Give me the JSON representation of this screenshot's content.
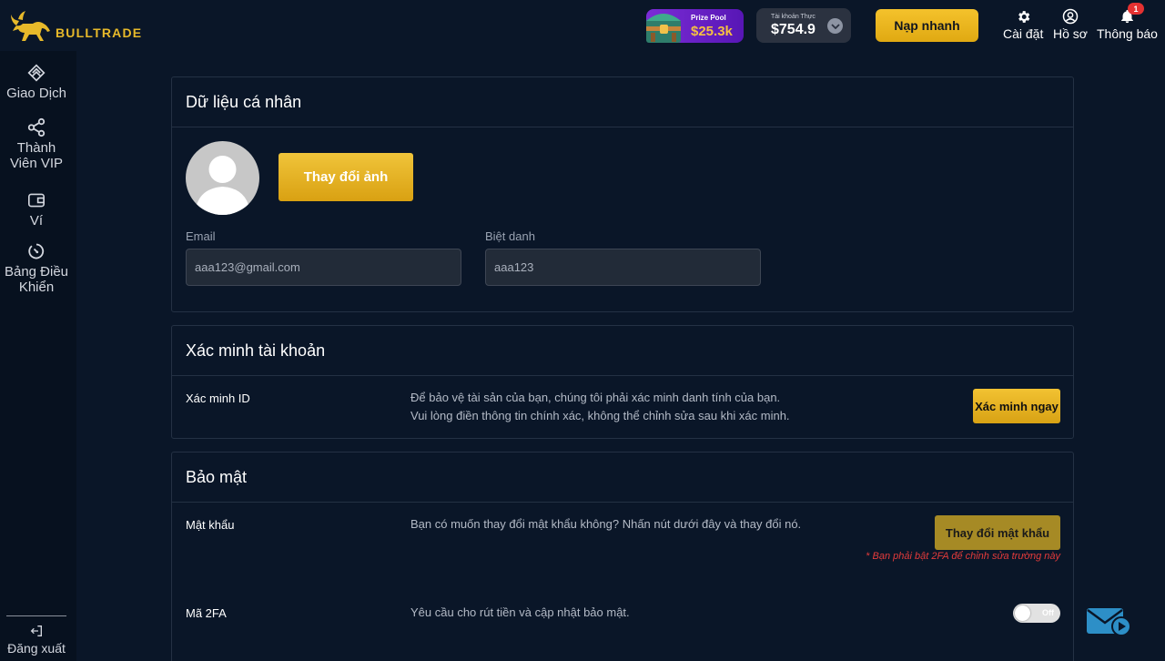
{
  "brand": {
    "name": "BULLTRADE",
    "accent": "#e7b92a"
  },
  "header": {
    "prize_pool": {
      "label": "Prize Pool",
      "value": "$25.3k"
    },
    "account": {
      "label": "Tài khoản Thực",
      "value": "$754.9"
    },
    "deposit_label": "Nạp nhanh",
    "settings_label": "Cài đặt",
    "profile_label": "Hồ sơ",
    "notifications_label": "Thông báo",
    "notifications_count": "1"
  },
  "sidebar": {
    "items": [
      {
        "label": "Giao Dịch",
        "icon": "trade-icon"
      },
      {
        "label": "Thành Viên VIP",
        "icon": "share-icon"
      },
      {
        "label": "Ví",
        "icon": "wallet-icon"
      },
      {
        "label": "Bảng Điều Khiển",
        "icon": "dashboard-icon"
      }
    ],
    "logout_label": "Đăng xuất"
  },
  "personal": {
    "title": "Dữ liệu cá nhân",
    "change_photo_label": "Thay đổi ảnh",
    "email_label": "Email",
    "email_value": "aaa123@gmail.com",
    "nickname_label": "Biệt danh",
    "nickname_value": "aaa123"
  },
  "verification": {
    "title": "Xác minh tài khoản",
    "row_label": "Xác minh ID",
    "desc_line1": "Để bảo vệ tài sản của bạn, chúng tôi phải xác minh danh tính của bạn.",
    "desc_line2": "Vui lòng điền thông tin chính xác, không thể chỉnh sửa sau khi xác minh.",
    "button_label": "Xác minh ngay"
  },
  "security": {
    "title": "Bảo mật",
    "password_label": "Mật khẩu",
    "password_desc": "Bạn có muốn thay đổi mật khẩu không? Nhấn nút dưới đây và thay đổi nó.",
    "password_button": "Thay đổi mật khẩu",
    "password_warning": "* Bạn phải bật 2FA để chỉnh sửa trường này",
    "twofa_label": "Mã 2FA",
    "twofa_desc": "Yêu cầu cho rút tiền và cập nhật bảo mật.",
    "twofa_state": "Off"
  }
}
